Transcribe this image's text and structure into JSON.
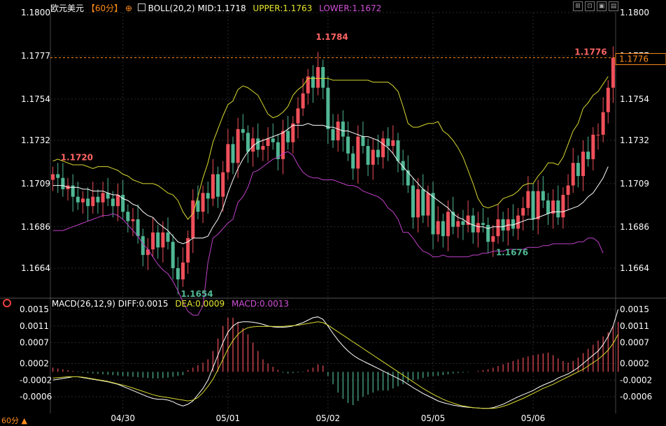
{
  "header": {
    "instrument": "欧元美元",
    "period": "【60分】",
    "indicator": "BOLL(20,2)",
    "mid": "MID:1.1718",
    "upper": "UPPER:1.1763",
    "lower": "LOWER:1.1672"
  },
  "macd_header": {
    "name": "MACD(26,12,9)",
    "diff": "DIFF:0.0015",
    "dea": "DEA:0.0009",
    "macd": "MACD:0.0013"
  },
  "footer": {
    "period": "60分"
  },
  "toolbar": [
    "⊞",
    "⊡",
    "▣",
    "▤"
  ],
  "colors": {
    "bg": "#000000",
    "grid": "#2a2a2a",
    "up": "#f0505a",
    "down": "#50b894",
    "mid": "#ffffff",
    "upper": "#d8d830",
    "lower": "#c040c8",
    "label": "#ff6464",
    "low_label": "#50b894",
    "axis_text": "#ffffff"
  },
  "chart_data": [
    {
      "type": "candlestick",
      "title": "欧元美元 60分 BOLL(20,2)",
      "ylim": [
        1.1648,
        1.18
      ],
      "y_ticks": [
        "1.1664",
        "1.1686",
        "1.1709",
        "1.1732",
        "1.1754",
        "1.1777",
        "1.1800"
      ],
      "x_ticks": [
        "04/30",
        "05/01",
        "05/02",
        "05/05",
        "05/06"
      ],
      "x_tick_index": [
        14,
        35,
        55,
        76,
        96
      ],
      "current_price": "1.1776",
      "annotations": [
        {
          "text": "1.1720",
          "index": 1,
          "value": 1.172
        },
        {
          "text": "1.1654",
          "index": 25,
          "value": 1.1654
        },
        {
          "text": "1.1784",
          "index": 52,
          "value": 1.1784
        },
        {
          "text": "1.1676",
          "index": 88,
          "value": 1.1676
        },
        {
          "text": "1.1776",
          "index": 111,
          "value": 1.1776
        }
      ],
      "closes": [
        1.1714,
        1.1712,
        1.1706,
        1.1708,
        1.1702,
        1.1699,
        1.1701,
        1.1697,
        1.1702,
        1.1699,
        1.1704,
        1.1701,
        1.1697,
        1.1703,
        1.1694,
        1.1689,
        1.169,
        1.1681,
        1.1671,
        1.1674,
        1.1683,
        1.1675,
        1.1683,
        1.1678,
        1.1664,
        1.1658,
        1.1667,
        1.168,
        1.17,
        1.1694,
        1.1704,
        1.1701,
        1.1714,
        1.1702,
        1.1715,
        1.173,
        1.172,
        1.1738,
        1.1736,
        1.1726,
        1.1733,
        1.1727,
        1.1729,
        1.1733,
        1.1731,
        1.1722,
        1.1737,
        1.1731,
        1.1741,
        1.1749,
        1.1757,
        1.1766,
        1.176,
        1.1771,
        1.176,
        1.1738,
        1.1732,
        1.1742,
        1.1734,
        1.1725,
        1.1717,
        1.1734,
        1.1729,
        1.1719,
        1.1727,
        1.1723,
        1.1733,
        1.1729,
        1.1732,
        1.1721,
        1.1716,
        1.1708,
        1.1691,
        1.1706,
        1.1692,
        1.1704,
        1.1682,
        1.1689,
        1.1681,
        1.1694,
        1.1686,
        1.1689,
        1.1687,
        1.1692,
        1.1683,
        1.1688,
        1.1687,
        1.1678,
        1.1681,
        1.169,
        1.1684,
        1.169,
        1.1685,
        1.1692,
        1.1696,
        1.1705,
        1.169,
        1.1705,
        1.17,
        1.1693,
        1.17,
        1.1691,
        1.1703,
        1.1708,
        1.172,
        1.1713,
        1.1726,
        1.1722,
        1.1735,
        1.1735,
        1.1747,
        1.176,
        1.1776
      ],
      "boll": {
        "upper": [
          1.1721,
          1.1722,
          1.1721,
          1.172,
          1.1719,
          1.1719,
          1.1719,
          1.1718,
          1.1717,
          1.1718,
          1.1718,
          1.1718,
          1.1717,
          1.1716,
          1.1714,
          1.1713,
          1.1711,
          1.171,
          1.1709,
          1.1709,
          1.1709,
          1.1708,
          1.1706,
          1.1704,
          1.1703,
          1.17,
          1.1694,
          1.169,
          1.1693,
          1.1702,
          1.1712,
          1.172,
          1.1731,
          1.1738,
          1.1745,
          1.1751,
          1.1753,
          1.1759,
          1.1761,
          1.176,
          1.1758,
          1.1756,
          1.1751,
          1.1746,
          1.1744,
          1.1745,
          1.1747,
          1.175,
          1.1756,
          1.1759,
          1.1761,
          1.1765,
          1.1765,
          1.1765,
          1.1765,
          1.1765,
          1.1764,
          1.1764,
          1.1764,
          1.1764,
          1.1764,
          1.1764,
          1.1764,
          1.1764,
          1.1763,
          1.1763,
          1.1763,
          1.1763,
          1.1761,
          1.1758,
          1.175,
          1.1741,
          1.1739,
          1.1739,
          1.174,
          1.1741,
          1.1741,
          1.1742,
          1.1737,
          1.1735,
          1.1732,
          1.1728,
          1.1723,
          1.1716,
          1.1709,
          1.1701,
          1.1697,
          1.1696,
          1.1697,
          1.1698,
          1.1701,
          1.1702,
          1.1703,
          1.1705,
          1.1708,
          1.1709,
          1.1709,
          1.1713,
          1.1716,
          1.172,
          1.172,
          1.1719,
          1.1723,
          1.173,
          1.1737,
          1.1741,
          1.1749,
          1.1752,
          1.1756,
          1.1758,
          1.1762,
          1.1766
        ],
        "mid": [
          1.1708,
          1.1708,
          1.1708,
          1.1707,
          1.1707,
          1.1707,
          1.1706,
          1.1706,
          1.1705,
          1.1705,
          1.1705,
          1.1704,
          1.1703,
          1.1703,
          1.1701,
          1.17,
          1.1698,
          1.1697,
          1.1694,
          1.1692,
          1.1691,
          1.1688,
          1.1686,
          1.1684,
          1.1681,
          1.1678,
          1.1677,
          1.1678,
          1.168,
          1.168,
          1.168,
          1.1681,
          1.1686,
          1.169,
          1.1696,
          1.1704,
          1.1711,
          1.1717,
          1.1722,
          1.1726,
          1.1729,
          1.1731,
          1.1732,
          1.1733,
          1.1734,
          1.1735,
          1.1736,
          1.1738,
          1.174,
          1.174,
          1.174,
          1.1741,
          1.174,
          1.174,
          1.174,
          1.1739,
          1.1739,
          1.1738,
          1.1737,
          1.1737,
          1.1736,
          1.1735,
          1.1734,
          1.1734,
          1.1733,
          1.1732,
          1.173,
          1.1728,
          1.1725,
          1.1721,
          1.1718,
          1.1715,
          1.1712,
          1.1709,
          1.1706,
          1.1704,
          1.1702,
          1.17,
          1.1698,
          1.1696,
          1.1693,
          1.1691,
          1.169,
          1.1688,
          1.1687,
          1.1686,
          1.1686,
          1.1685,
          1.1686,
          1.1686,
          1.1686,
          1.1687,
          1.1687,
          1.1688,
          1.1689,
          1.169,
          1.169,
          1.1691,
          1.1692,
          1.1693,
          1.1694,
          1.1694,
          1.1694,
          1.1695,
          1.1696,
          1.1697,
          1.1699,
          1.1702,
          1.1704,
          1.1708,
          1.1712,
          1.1718
        ],
        "lower": [
          1.1684,
          1.1684,
          1.1684,
          1.1685,
          1.1686,
          1.1687,
          1.1688,
          1.1689,
          1.169,
          1.1691,
          1.1692,
          1.1692,
          1.1693,
          1.1692,
          1.169,
          1.1687,
          1.1684,
          1.1681,
          1.1677,
          1.1674,
          1.167,
          1.1666,
          1.1663,
          1.1661,
          1.1657,
          1.1652,
          1.1646,
          1.1641,
          1.1639,
          1.1639,
          1.1644,
          1.1667,
          1.168,
          1.1682,
          1.1685,
          1.1688,
          1.169,
          1.1699,
          1.1702,
          1.1707,
          1.1715,
          1.1716,
          1.1718,
          1.172,
          1.1722,
          1.1723,
          1.1725,
          1.1726,
          1.1724,
          1.1719,
          1.1715,
          1.1713,
          1.1712,
          1.1712,
          1.1711,
          1.1711,
          1.1711,
          1.171,
          1.1709,
          1.1708,
          1.1708,
          1.1707,
          1.1705,
          1.1704,
          1.1703,
          1.1702,
          1.17,
          1.1696,
          1.1694,
          1.169,
          1.1683,
          1.1683,
          1.168,
          1.1676,
          1.1673,
          1.1672,
          1.167,
          1.167,
          1.1671,
          1.167,
          1.167,
          1.167,
          1.167,
          1.167,
          1.1671,
          1.1671,
          1.1672,
          1.1672,
          1.1673,
          1.1673,
          1.1673,
          1.1674,
          1.1674,
          1.1674,
          1.1674,
          1.1675,
          1.1675,
          1.1675,
          1.1676,
          1.1676,
          1.1677,
          1.1677,
          1.1677,
          1.1677,
          1.1677,
          1.1678,
          1.1678,
          1.168,
          1.168,
          1.1678,
          1.1672
        ]
      }
    },
    {
      "type": "bar",
      "title": "MACD(26,12,9)",
      "ylim": [
        -0.001,
        0.0016
      ],
      "y_ticks": [
        "0.0015",
        "0.0011",
        "0.0007",
        "0.0002",
        "-0.0002",
        "-0.0006"
      ],
      "series": [
        {
          "name": "DIFF",
          "values": [
            -0.0002,
            -0.00018,
            -0.00016,
            -0.00014,
            -0.00012,
            -0.00012,
            -0.00014,
            -0.00016,
            -0.00018,
            -0.0002,
            -0.00022,
            -0.00024,
            -0.00027,
            -0.0003,
            -0.00035,
            -0.0004,
            -0.00045,
            -0.0005,
            -0.00055,
            -0.0006,
            -0.00064,
            -0.00066,
            -0.00066,
            -0.00068,
            -0.00072,
            -0.00078,
            -0.00082,
            -0.00078,
            -0.0007,
            -0.00055,
            -0.0004,
            -0.0002,
            0.0001,
            0.0004,
            0.0007,
            0.00095,
            0.0011,
            0.00118,
            0.0012,
            0.0012,
            0.00119,
            0.00117,
            0.00114,
            0.0011,
            0.00108,
            0.00107,
            0.00107,
            0.00108,
            0.0011,
            0.00114,
            0.00118,
            0.00124,
            0.0013,
            0.00132,
            0.00126,
            0.0011,
            0.00092,
            0.00076,
            0.00062,
            0.0005,
            0.0004,
            0.00032,
            0.00026,
            0.0002,
            0.00014,
            8e-05,
            2e-05,
            -4e-05,
            -0.0001,
            -0.00016,
            -0.00022,
            -0.0003,
            -0.00038,
            -0.00045,
            -0.00052,
            -0.00058,
            -0.00064,
            -0.0007,
            -0.00074,
            -0.00077,
            -0.0008,
            -0.00082,
            -0.00084,
            -0.00085,
            -0.00086,
            -0.00087,
            -0.00088,
            -0.00088,
            -0.00086,
            -0.00082,
            -0.00078,
            -0.00072,
            -0.00066,
            -0.0006,
            -0.00055,
            -0.0005,
            -0.00045,
            -0.00038,
            -0.00032,
            -0.00027,
            -0.00022,
            -0.00015,
            -0.0001,
            -5e-05,
            2e-05,
            0.0001,
            0.0002,
            0.0003,
            0.0004,
            0.0005,
            0.00065,
            0.00085,
            0.0011,
            0.0015
          ]
        },
        {
          "name": "DEA",
          "values": [
            -0.00015,
            -0.00014,
            -0.00013,
            -0.00012,
            -0.00012,
            -0.00012,
            -0.00013,
            -0.00015,
            -0.00017,
            -0.00019,
            -0.00021,
            -0.00023,
            -0.00026,
            -0.00029,
            -0.00032,
            -0.00035,
            -0.00039,
            -0.00043,
            -0.00047,
            -0.00051,
            -0.00055,
            -0.00058,
            -0.0006,
            -0.00062,
            -0.00064,
            -0.00066,
            -0.00068,
            -0.0007,
            -0.00068,
            -0.00062,
            -0.0005,
            -0.00035,
            -0.00018,
            5e-05,
            0.0003,
            0.00055,
            0.00075,
            0.0009,
            0.001,
            0.00106,
            0.00108,
            0.00109,
            0.00109,
            0.00109,
            0.00109,
            0.00109,
            0.00109,
            0.0011,
            0.00111,
            0.00112,
            0.00114,
            0.00116,
            0.00118,
            0.0012,
            0.00118,
            0.00112,
            0.00104,
            0.00096,
            0.00088,
            0.0008,
            0.00072,
            0.00064,
            0.00056,
            0.00048,
            0.0004,
            0.00032,
            0.00024,
            0.00016,
            8e-05,
            0.0,
            -8e-05,
            -0.00016,
            -0.00024,
            -0.00032,
            -0.0004,
            -0.00047,
            -0.00054,
            -0.0006,
            -0.00066,
            -0.00071,
            -0.00075,
            -0.00079,
            -0.00082,
            -0.00084,
            -0.00086,
            -0.00087,
            -0.00088,
            -0.00088,
            -0.00088,
            -0.00086,
            -0.00083,
            -0.00079,
            -0.00074,
            -0.00069,
            -0.00064,
            -0.00058,
            -0.00052,
            -0.00046,
            -0.0004,
            -0.00035,
            -0.0003,
            -0.00024,
            -0.00018,
            -0.00012,
            -6e-05,
            0.0,
            6e-05,
            0.00014,
            0.00022,
            0.0003,
            0.0004,
            0.00052,
            0.00068,
            0.0009
          ]
        },
        {
          "name": "MACD",
          "values": [
            0.0001,
            8e-05,
            6e-05,
            4e-05,
            2e-05,
            -1e-05,
            -2e-05,
            -3e-05,
            -4e-05,
            -5e-05,
            -6e-05,
            -7e-05,
            -8e-05,
            -9e-05,
            -0.0001,
            -0.00011,
            -0.00012,
            -0.00013,
            -0.00014,
            -0.00015,
            -0.00016,
            -0.00016,
            -0.00015,
            -0.00014,
            -0.00012,
            -0.0001,
            -8e-05,
            4e-05,
            0.0001,
            0.00016,
            0.00022,
            0.0003,
            0.0005,
            0.0008,
            0.0011,
            0.0013,
            0.0013,
            0.0012,
            0.00105,
            0.0009,
            0.0007,
            0.0005,
            0.0003,
            0.0002,
            0.00012,
            5e-05,
            -2e-05,
            -4e-05,
            -3e-05,
            -2e-05,
            -1e-05,
            5e-05,
            0.0001,
            0.00018,
            0.00015,
            -0.0001,
            -0.0003,
            -0.0005,
            -0.00065,
            -0.00075,
            -0.0008,
            -0.0007,
            -0.0006,
            -0.00055,
            -0.0005,
            -0.00045,
            -0.00045,
            -0.00045,
            -0.0004,
            -0.00035,
            -0.0003,
            -0.00025,
            -0.0002,
            -0.00018,
            -0.00015,
            -0.00012,
            -0.0001,
            -0.0001,
            -8e-05,
            -6e-05,
            -4e-05,
            -3e-05,
            -2e-05,
            -1e-05,
            0.0,
            2e-05,
            4e-05,
            6e-05,
            0.0001,
            0.00014,
            0.00018,
            0.00022,
            0.00026,
            0.0003,
            0.00034,
            0.00037,
            0.0004,
            0.00042,
            0.00044,
            0.00046,
            0.0004,
            0.00032,
            0.00026,
            0.00022,
            0.00026,
            0.00034,
            0.00045,
            0.00055,
            0.00065,
            0.00075,
            0.00085,
            0.00095,
            0.0011,
            0.0012
          ]
        }
      ]
    }
  ]
}
